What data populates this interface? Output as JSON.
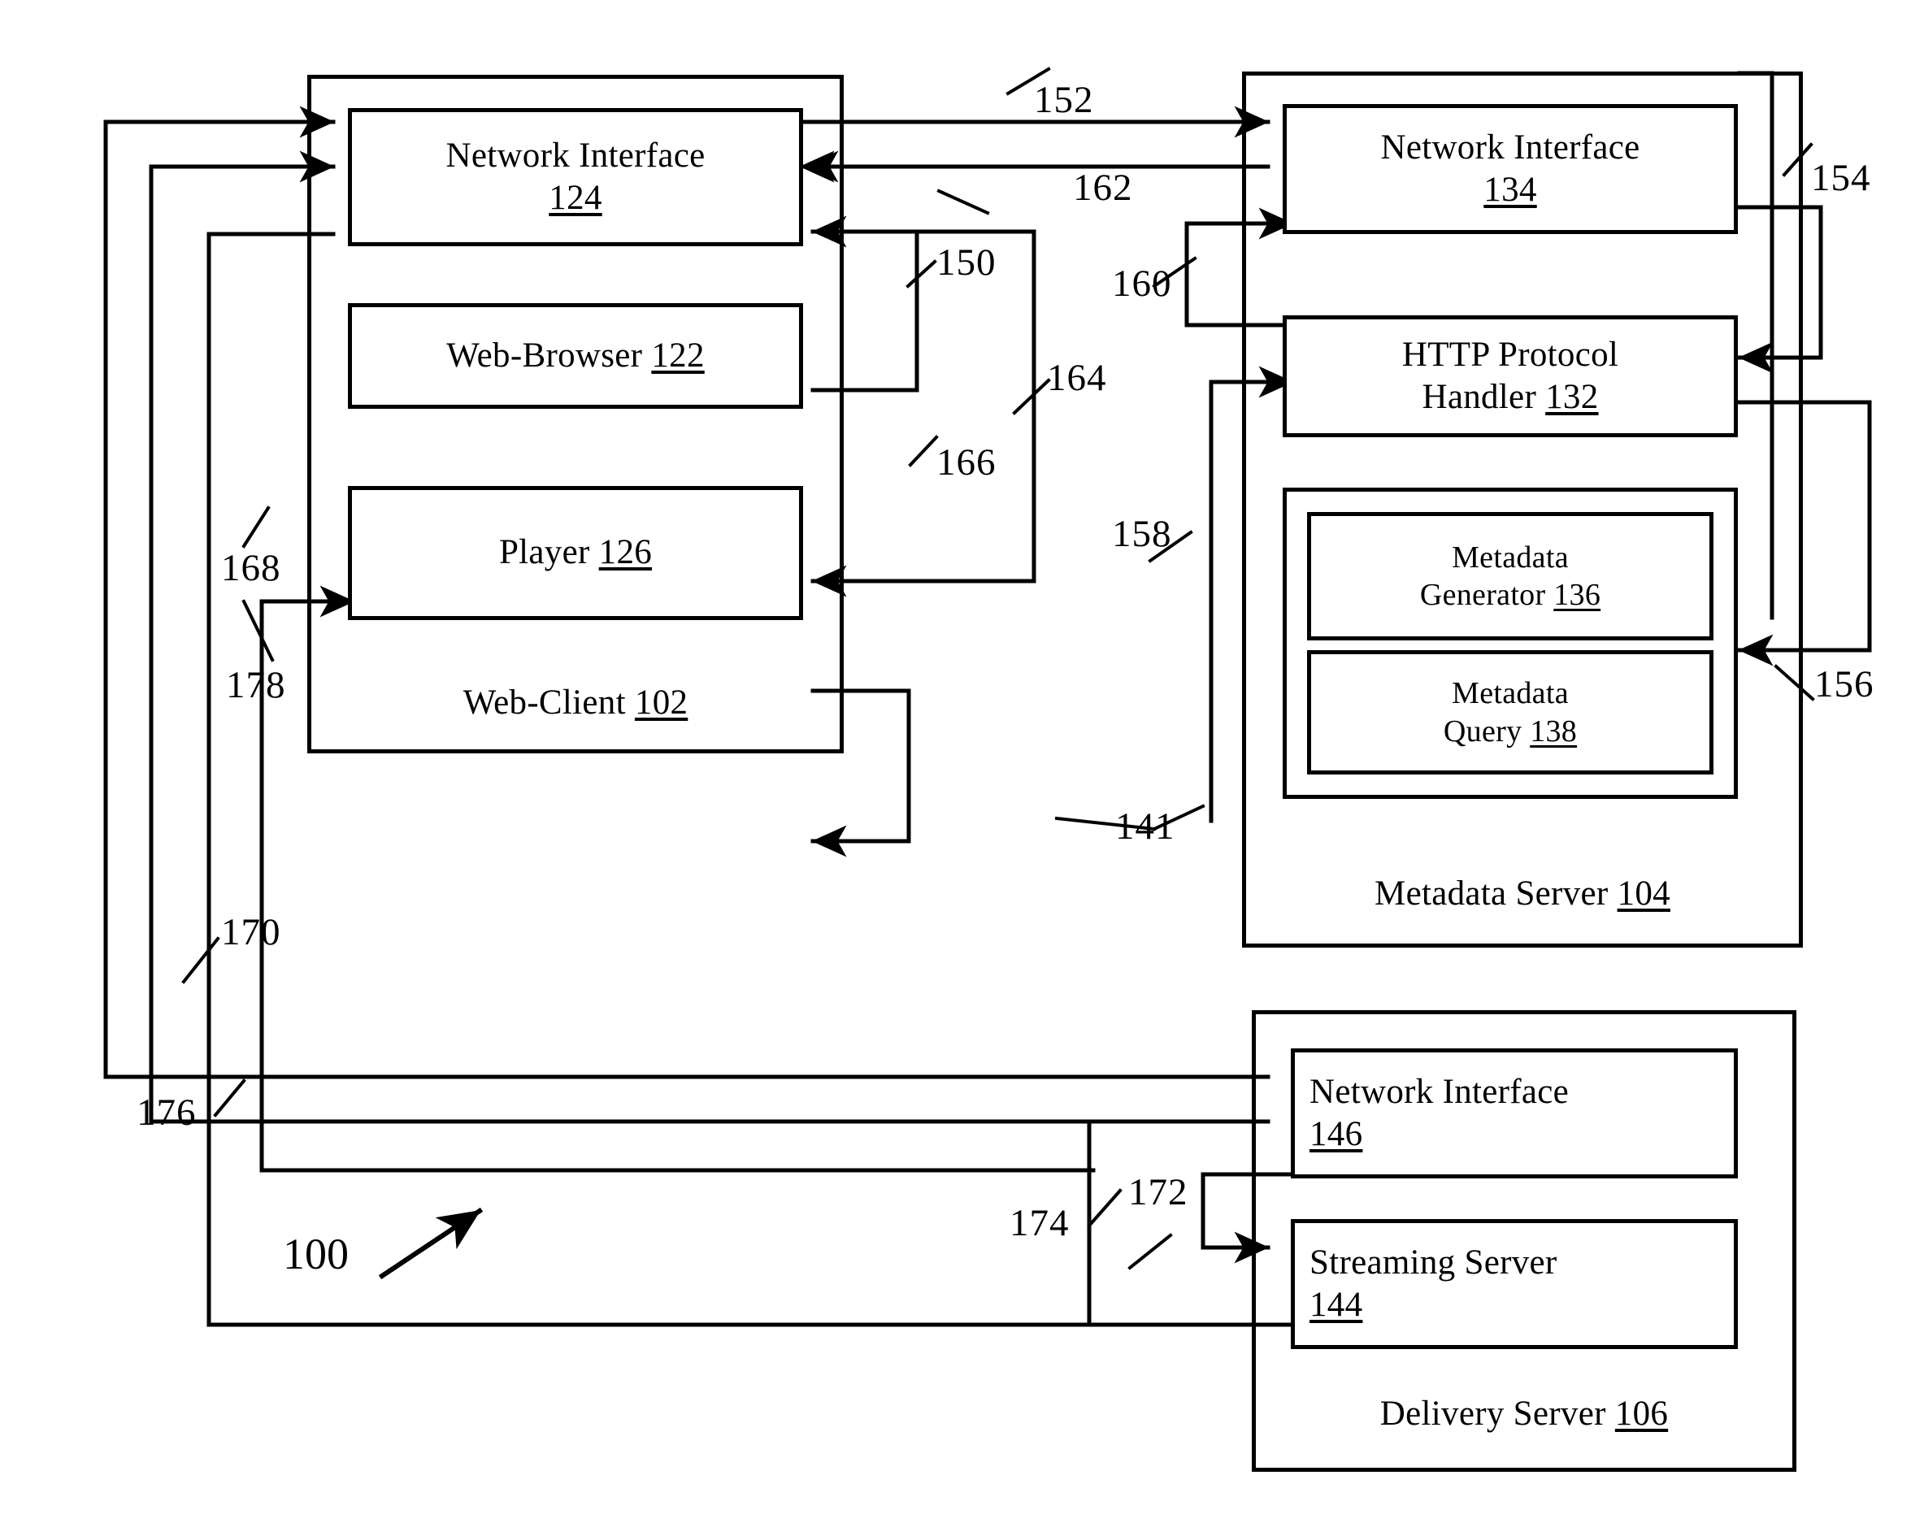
{
  "figure": {
    "figure_number": "100",
    "title_text": ""
  },
  "blocks": [
    {
      "id": "ni124",
      "line1": "Network Interface",
      "num": "124"
    },
    {
      "id": "wb122",
      "line1": "Web-Browser",
      "num": "122"
    },
    {
      "id": "pl126",
      "line1": "Player",
      "num": "126"
    },
    {
      "id": "ni134",
      "line1": "Network Interface",
      "num": "134"
    },
    {
      "id": "http132",
      "line1": "HTTP Protocol",
      "line2": "Handler",
      "num": "132"
    },
    {
      "id": "mg136",
      "line1": "Metadata",
      "line2": "Generator",
      "num": "136"
    },
    {
      "id": "mq138",
      "line1": "Metadata",
      "line2": "Query",
      "num": "138"
    },
    {
      "id": "ni146",
      "line1": "Network Interface",
      "num": "146"
    },
    {
      "id": "ss144",
      "line1": "Streaming Server",
      "num": "144"
    }
  ],
  "containers": [
    {
      "id": "webclient",
      "label": "Web-Client",
      "num": "102"
    },
    {
      "id": "metaserver",
      "label": "Metadata Server",
      "num": "104"
    },
    {
      "id": "delivserver",
      "label": "Delivery Server",
      "num": "106"
    },
    {
      "id": "metagroup",
      "label": "",
      "num": "141"
    }
  ],
  "ref_labels": {
    "r150": "150",
    "r152": "152",
    "r154": "154",
    "r156": "156",
    "r158": "158",
    "r160": "160",
    "r162": "162",
    "r164": "164",
    "r166": "166",
    "r168": "168",
    "r170": "170",
    "r172": "172",
    "r174": "174",
    "r176": "176",
    "r178": "178",
    "r141": "141",
    "r100": "100"
  },
  "colors": {
    "line": "#000000",
    "background": "#ffffff"
  }
}
